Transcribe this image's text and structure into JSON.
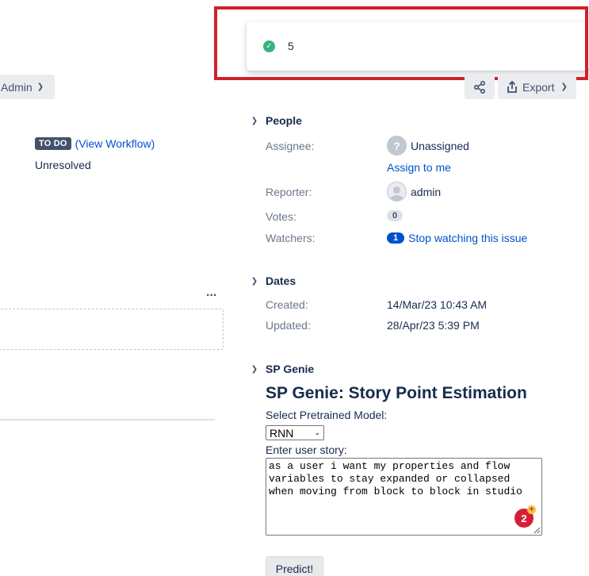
{
  "left": {
    "admin_button": "Admin",
    "status_lozenge": "TO DO",
    "view_workflow": "(View Workflow)",
    "resolution": "Unresolved",
    "more_icon": "..."
  },
  "flag": {
    "count": "5",
    "icon": "check-circle-icon"
  },
  "toolbar": {
    "share_icon": "share-icon",
    "export_label": "Export"
  },
  "people": {
    "heading": "People",
    "assignee_label": "Assignee:",
    "assignee_value": "Unassigned",
    "assign_to_me": "Assign to me",
    "reporter_label": "Reporter:",
    "reporter_value": "admin",
    "votes_label": "Votes:",
    "votes_value": "0",
    "watchers_label": "Watchers:",
    "watchers_count": "1",
    "watchers_link": "Stop watching this issue"
  },
  "dates": {
    "heading": "Dates",
    "created_label": "Created:",
    "created_value": "14/Mar/23 10:43 AM",
    "updated_label": "Updated:",
    "updated_value": "28/Apr/23 5:39 PM"
  },
  "sp_genie": {
    "heading": "SP Genie",
    "title": "SP Genie: Story Point Estimation",
    "model_label": "Select Pretrained Model:",
    "model_value": "RNN",
    "story_label": "Enter user story:",
    "story_text": "as a user i want my properties and flow variables to stay expanded or collapsed when moving from block to block in studio",
    "grammar_badge": "2",
    "grammar_plus": "+",
    "predict_button": "Predict!"
  },
  "colors": {
    "highlight_border": "#d0202a",
    "success": "#36b37e",
    "link": "#0052cc",
    "lozenge": "#42526e"
  }
}
